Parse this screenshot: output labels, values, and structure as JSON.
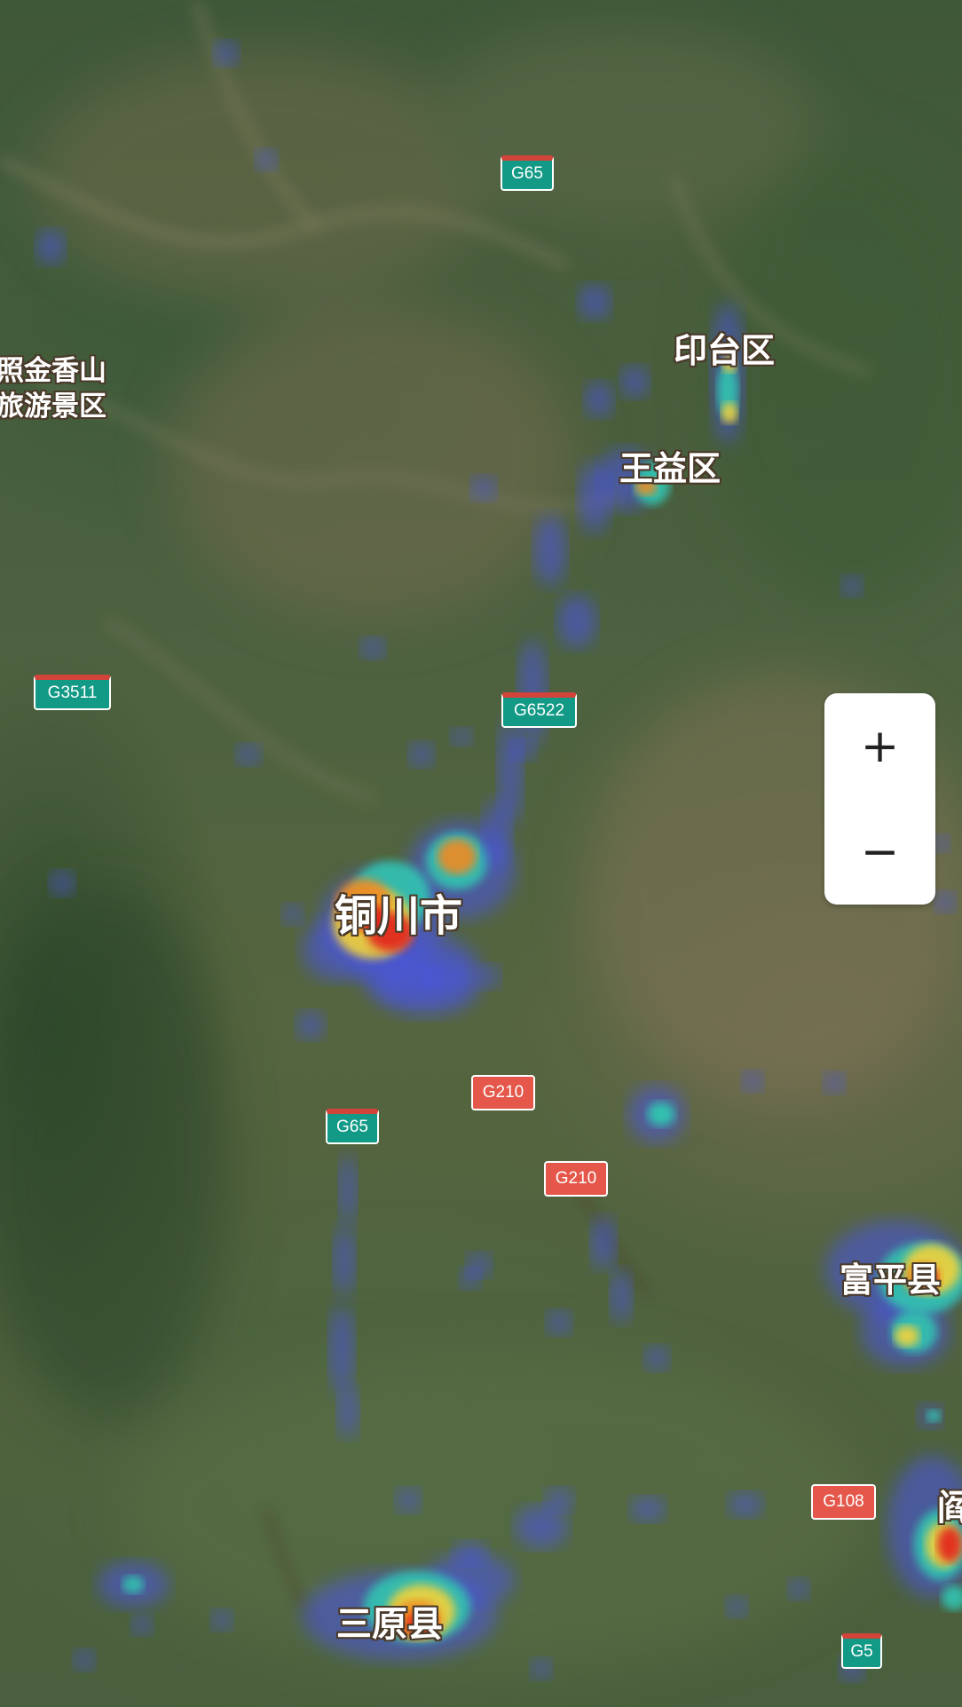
{
  "map": {
    "view": "satellite",
    "overlay": "heatmap",
    "heatmap_colors": [
      "#4a55e8",
      "#33c4b0",
      "#f2d23a",
      "#f08a24",
      "#e2221a"
    ],
    "place_labels": [
      {
        "id": "jinxiangshan",
        "text": "照金香山\n旅游景区"
      },
      {
        "id": "yintai",
        "text": "印台区"
      },
      {
        "id": "wangyi",
        "text": "王益区"
      },
      {
        "id": "tongchuan",
        "text": "铜川市"
      },
      {
        "id": "fuping",
        "text": "富平县"
      },
      {
        "id": "sanyuan",
        "text": "三原县"
      },
      {
        "id": "partial-right",
        "text": "阎"
      }
    ],
    "road_shields": [
      {
        "id": "g65-north",
        "text": "G65",
        "type": "expressway"
      },
      {
        "id": "g3511",
        "text": "G3511",
        "type": "expressway"
      },
      {
        "id": "g6522",
        "text": "G6522",
        "type": "expressway"
      },
      {
        "id": "g210-a",
        "text": "G210",
        "type": "national"
      },
      {
        "id": "g65-south",
        "text": "G65",
        "type": "expressway"
      },
      {
        "id": "g210-b",
        "text": "G210",
        "type": "national"
      },
      {
        "id": "g108",
        "text": "G108",
        "type": "national"
      },
      {
        "id": "g5",
        "text": "G5",
        "type": "expressway"
      }
    ]
  },
  "zoom_control": {
    "zoom_in_label": "+",
    "zoom_out_label": "−",
    "zoom_in_icon": "plus-icon",
    "zoom_out_icon": "minus-icon"
  }
}
